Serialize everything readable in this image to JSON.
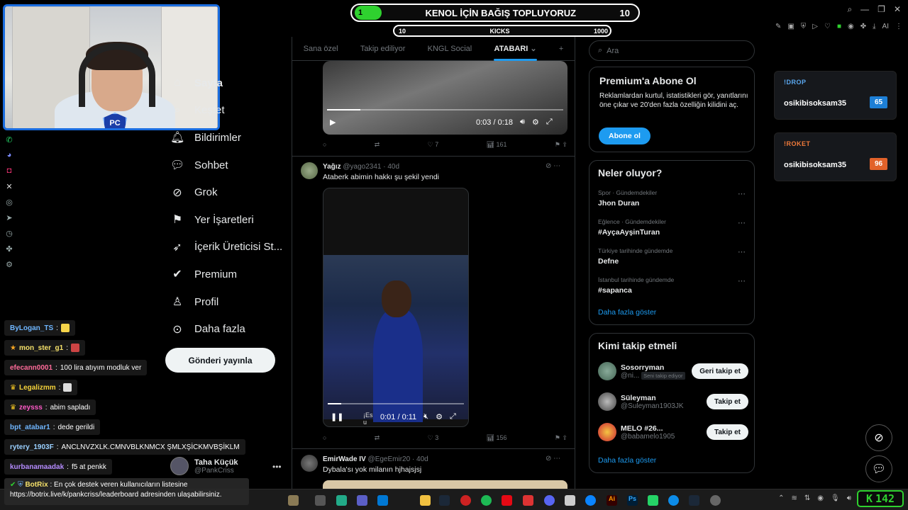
{
  "overlay": {
    "goal_start": "1",
    "goal_title": "KENOL İÇİN BAĞIŞ TOPLUYORUZ",
    "goal_end": "10",
    "kicks_left": "10",
    "kicks_label": "KICKS",
    "kicks_right": "1000",
    "counter": "142"
  },
  "nav": {
    "items": [
      {
        "label": "Sayfa",
        "icon": "home-icon"
      },
      {
        "label": "Keşfet",
        "icon": "search-icon"
      },
      {
        "label": "Bildirimler",
        "icon": "bell-icon"
      },
      {
        "label": "Sohbet",
        "icon": "chat-icon"
      },
      {
        "label": "Grok",
        "icon": "grok-icon"
      },
      {
        "label": "Yer İşaretleri",
        "icon": "bookmark-icon"
      },
      {
        "label": "İçerik Üreticisi St...",
        "icon": "rocket-icon"
      },
      {
        "label": "Premium",
        "icon": "verified-icon"
      },
      {
        "label": "Profil",
        "icon": "user-icon"
      },
      {
        "label": "Daha fazla",
        "icon": "more-icon"
      }
    ],
    "post_button": "Gönderi yayınla",
    "user_name": "Taha Küçük",
    "user_handle": "@PankCriss"
  },
  "feed": {
    "tabs": [
      "Sana özel",
      "Takip ediliyor",
      "KNGL Social",
      "ATABARI"
    ],
    "video1": {
      "time": "0:03 / 0:18"
    },
    "tweet1_actions": {
      "reply": "",
      "retweet": "",
      "likes": "7",
      "views": "161"
    },
    "tweet2": {
      "name": "Yağız",
      "handle": "@yago2341",
      "age": "· 40d",
      "text": "Ataberk abimin hakkı şu şekil yendi",
      "video_time": "0:01 / 0:11",
      "video_caption": "¡Es u",
      "likes": "3",
      "views": "156"
    },
    "tweet3": {
      "name": "EmirWade IV",
      "handle": "@EgeEmir20",
      "age": "· 40d",
      "text": "Dybala'sı yok milanın hjhajsjsj"
    }
  },
  "right": {
    "search_placeholder": "Ara",
    "premium": {
      "title": "Premium'a Abone Ol",
      "desc": "Reklamlardan kurtul, istatistikleri gör, yanıtlarını öne çıkar ve 20'den fazla özelliğin kilidini aç.",
      "button": "Abone ol"
    },
    "trends_title": "Neler oluyor?",
    "trends": [
      {
        "cat": "Spor · Gündemdekiler",
        "name": "Jhon Duran"
      },
      {
        "cat": "Eğlence · Gündemdekiler",
        "name": "#AyçaAyşinTuran"
      },
      {
        "cat": "Türkiye tarihinde gündemde",
        "name": "Defne"
      },
      {
        "cat": "İstanbul tarihinde gündemde",
        "name": "#sapanca"
      }
    ],
    "show_more": "Daha fazla göster",
    "who_title": "Kimi takip etmeli",
    "who": [
      {
        "name": "Sosorryman",
        "handle": "@ni...",
        "badge": "Seni takip ediyor",
        "button": "Geri takip et"
      },
      {
        "name": "Süleyman",
        "handle": "@Suleyman1903JK",
        "badge": "",
        "button": "Takip et"
      },
      {
        "name": "MELO #26...",
        "handle": "@babamelo1905",
        "badge": "",
        "button": "Takip et"
      }
    ],
    "who_more": "Daha fazla göster"
  },
  "widgets": [
    {
      "title": "!DROP",
      "user": "osikibisoksam35",
      "value": "65",
      "color": "#1d7fd6",
      "title_color": "#5aa8f0"
    },
    {
      "title": "!ROKET",
      "user": "osikibisoksam35",
      "value": "96",
      "color": "#e2622a",
      "title_color": "#f07a3a"
    }
  ],
  "chat": [
    {
      "user": "ByLogan_TS",
      "text": "",
      "color": "#6fb6ff"
    },
    {
      "user": "mon_ster_g1",
      "text": "",
      "color": "#f5e16a"
    },
    {
      "user": "efecann0001",
      "text": "100 lira atıyım modluk ver",
      "color": "#ff6b9a"
    },
    {
      "user": "Legalizmm",
      "text": "",
      "color": "#f5d23a"
    },
    {
      "user": "zeysss",
      "text": "abim sapladı",
      "color": "#ff5ac8"
    },
    {
      "user": "bpt_atabar1",
      "text": "dede geri‌ldi",
      "color": "#6fb6ff"
    },
    {
      "user": "rytery_1903F",
      "text": "ANCLNVZXLK.CMNVBLKNMCX ŞMLXŞİCKMVBŞİKLM",
      "color": "#9ad0ff"
    },
    {
      "user": "kurbanamaadak",
      "text": "f5 at penkk",
      "color": "#b58cff"
    }
  ],
  "bot": {
    "user": "BotRix",
    "line1": "En çok destek veren kullanıcıların listesine",
    "line2": "https://botrix.live/k/pankcriss/leaderboard adresinden ulaşabilirsiniz."
  }
}
